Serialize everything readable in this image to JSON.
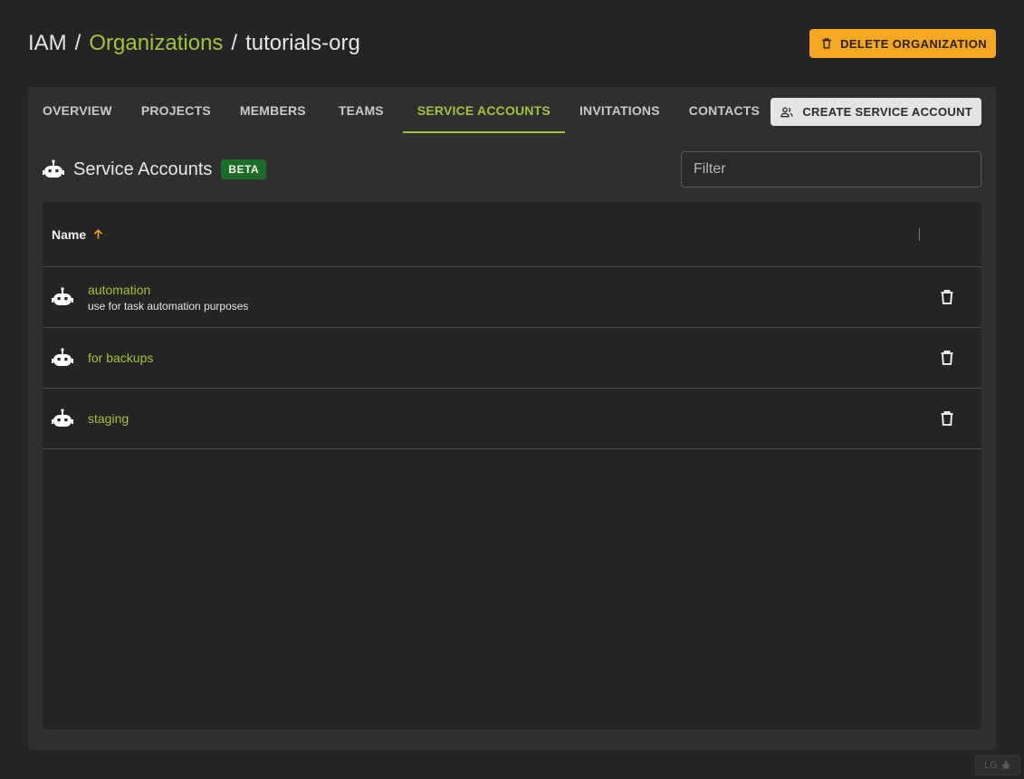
{
  "breadcrumb": {
    "root": "IAM",
    "separator": "/",
    "parent": "Organizations",
    "current": "tutorials-org"
  },
  "header": {
    "delete_button_label": "DELETE ORGANIZATION"
  },
  "tabs": [
    {
      "label": "OVERVIEW",
      "active": false
    },
    {
      "label": "PROJECTS",
      "active": false
    },
    {
      "label": "MEMBERS",
      "active": false
    },
    {
      "label": "TEAMS",
      "active": false
    },
    {
      "label": "SERVICE ACCOUNTS",
      "active": true
    },
    {
      "label": "INVITATIONS",
      "active": false
    },
    {
      "label": "CONTACTS",
      "active": false
    }
  ],
  "actions": {
    "create_label": "CREATE SERVICE ACCOUNT"
  },
  "section": {
    "title": "Service Accounts",
    "badge": "BETA",
    "filter_placeholder": "Filter"
  },
  "table": {
    "columns": [
      {
        "label": "Name",
        "sort": "ascending"
      }
    ],
    "rows": [
      {
        "name": "automation",
        "description": "use for task automation purposes"
      },
      {
        "name": "for backups",
        "description": ""
      },
      {
        "name": "staging",
        "description": ""
      }
    ]
  },
  "corner": {
    "label": "LG"
  },
  "colors": {
    "accent": "#a3c23c",
    "warning": "#f5a623",
    "badge": "#1f6b2a",
    "background": "#242424",
    "card": "#2f2f2f"
  },
  "icons": {
    "delete": "trash-icon",
    "create": "people-icon",
    "robot": "robot-icon",
    "sort": "arrow-up-icon",
    "corner": "bug-icon"
  }
}
